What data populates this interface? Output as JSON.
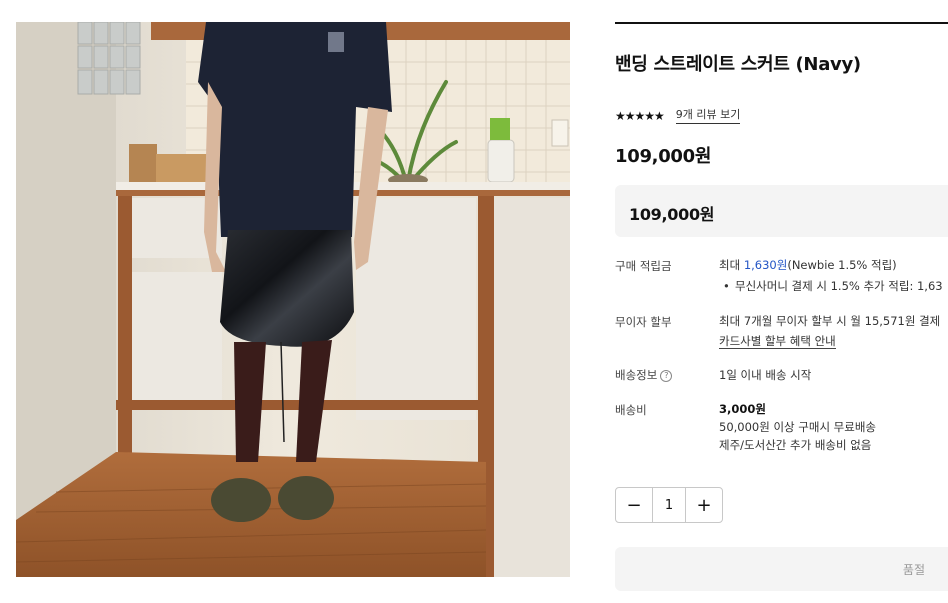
{
  "product": {
    "title": "밴딩 스트레이트 스커트 (Navy)",
    "stars": "★★★★★",
    "review_link": "9개 리뷰 보기",
    "price": "109,000원",
    "price_box": "109,000원"
  },
  "details": {
    "points_label": "구매 적립금",
    "points_prefix": "최대 ",
    "points_amount": "1,630원",
    "points_suffix": "(Newbie 1.5% 적립)",
    "points_bullet": "무신사머니 결제 시 1.5% 추가 적립: 1,63",
    "installment_label": "무이자 할부",
    "installment_text": "최대 7개월 무이자 할부 시 월 15,571원 결제",
    "installment_link": "카드사별 할부 혜택 안내",
    "shipping_label": "배송정보",
    "shipping_help": "?",
    "shipping_text": "1일 이내 배송 시작",
    "fee_label": "배송비",
    "fee_amount": "3,000원",
    "fee_free": "50,000원 이상 구매시 무료배송",
    "fee_extra": "제주/도서산간 추가 배송비 없음"
  },
  "quantity": {
    "minus": "−",
    "value": "1",
    "plus": "+"
  },
  "soldout_label": "품절",
  "colors": {
    "accent_blue": "#2355c5",
    "box_bg": "#f4f4f4"
  }
}
